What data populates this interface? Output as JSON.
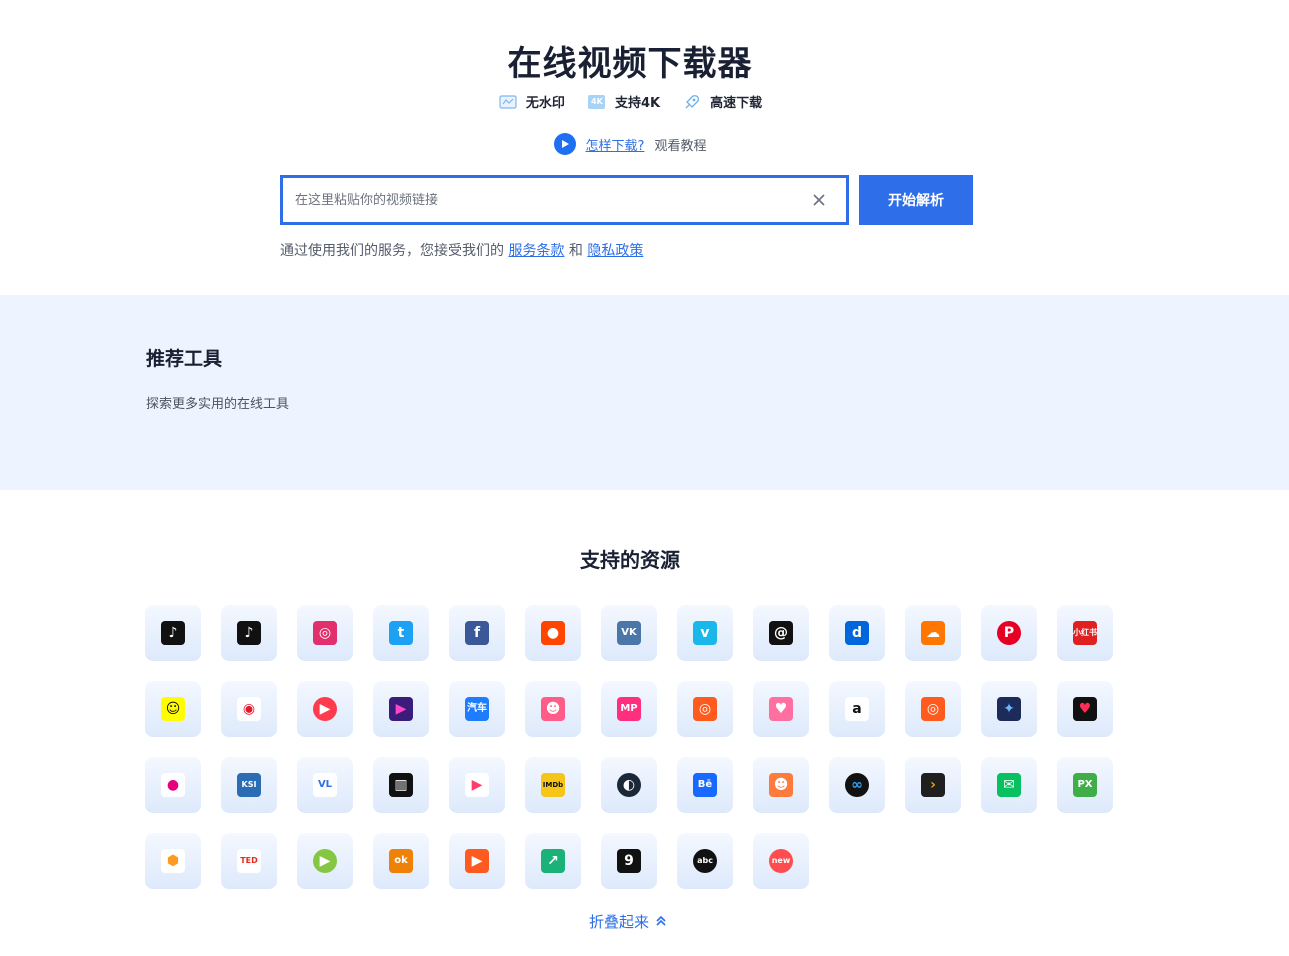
{
  "hero": {
    "title": "在线视频下载器",
    "features": [
      {
        "icon": "no-watermark-icon",
        "label": "无水印"
      },
      {
        "icon": "4k-icon",
        "label": "支持4K",
        "icon_text": "4K"
      },
      {
        "icon": "rocket-icon",
        "label": "高速下载"
      }
    ],
    "tutorial_link": "怎样下载?",
    "tutorial_text": "观看教程"
  },
  "search": {
    "placeholder": "在这里粘贴你的视频链接",
    "value": "",
    "submit_label": "开始解析"
  },
  "terms": {
    "prefix": "通过使用我们的服务，您接受我们的",
    "terms_link": "服务条款",
    "and": "和",
    "privacy_link": "隐私政策"
  },
  "recommended": {
    "title": "推荐工具",
    "subtitle": "探索更多实用的在线工具"
  },
  "sources": {
    "title": "支持的资源",
    "collapse_label": "折叠起来",
    "items": [
      {
        "name": "tiktok",
        "text": "♪",
        "bg": "#111111",
        "fg": "#ffffff"
      },
      {
        "name": "douyin",
        "text": "♪",
        "bg": "#111111",
        "fg": "#ffffff"
      },
      {
        "name": "instagram",
        "text": "◎",
        "bg": "#e1306c",
        "fg": "#ffffff"
      },
      {
        "name": "twitter",
        "text": "t",
        "bg": "#1da1f2",
        "fg": "#ffffff"
      },
      {
        "name": "facebook",
        "text": "f",
        "bg": "#3b5998",
        "fg": "#ffffff"
      },
      {
        "name": "reddit",
        "text": "●",
        "bg": "#ff4500",
        "fg": "#ffffff"
      },
      {
        "name": "vk",
        "text": "VK",
        "bg": "#4a76a8",
        "fg": "#ffffff"
      },
      {
        "name": "vimeo",
        "text": "v",
        "bg": "#19b7ea",
        "fg": "#ffffff"
      },
      {
        "name": "threads",
        "text": "@",
        "bg": "#111111",
        "fg": "#ffffff"
      },
      {
        "name": "dailymotion",
        "text": "d",
        "bg": "#0066dc",
        "fg": "#ffffff"
      },
      {
        "name": "soundcloud",
        "text": "☁",
        "bg": "#ff7700",
        "fg": "#ffffff"
      },
      {
        "name": "pinterest",
        "text": "P",
        "bg": "#e60023",
        "fg": "#ffffff",
        "round": true
      },
      {
        "name": "xiaohongshu",
        "text": "小红书",
        "bg": "#e02020",
        "fg": "#ffffff"
      },
      {
        "name": "snapchat",
        "text": "☺",
        "bg": "#fffc00",
        "fg": "#111111"
      },
      {
        "name": "weibo",
        "text": "◉",
        "bg": "#ffffff",
        "fg": "#e6162d"
      },
      {
        "name": "kuaishou-red",
        "text": "▶",
        "bg": "#ff3b4e",
        "fg": "#ffffff",
        "round": true
      },
      {
        "name": "purple-play",
        "text": "▶",
        "bg": "#3a1c7a",
        "fg": "#ff45c8"
      },
      {
        "name": "autohome",
        "text": "汽车",
        "bg": "#1e7cff",
        "fg": "#ffffff"
      },
      {
        "name": "pink-face",
        "text": "☻",
        "bg": "#ff5c8a",
        "fg": "#ffffff"
      },
      {
        "name": "mp",
        "text": "MP",
        "bg": "#ff2f7d",
        "fg": "#ffffff"
      },
      {
        "name": "kuaishou-orange",
        "text": "◎",
        "bg": "#ff5b1f",
        "fg": "#ffffff"
      },
      {
        "name": "pink-banner",
        "text": "♥",
        "bg": "#ff6fa0",
        "fg": "#ffffff"
      },
      {
        "name": "amazon",
        "text": "a",
        "bg": "#ffffff",
        "fg": "#111111"
      },
      {
        "name": "kuaishou",
        "text": "◎",
        "bg": "#ff5b1f",
        "fg": "#ffffff"
      },
      {
        "name": "star-app",
        "text": "✦",
        "bg": "#1c2b5a",
        "fg": "#6fb6ff"
      },
      {
        "name": "heart-app",
        "text": "♥",
        "bg": "#111111",
        "fg": "#ff2d55"
      },
      {
        "name": "pink-ball",
        "text": "●",
        "bg": "#ffffff",
        "fg": "#e6007e"
      },
      {
        "name": "ksi",
        "text": "KSI",
        "bg": "#2a6db5",
        "fg": "#ffffff"
      },
      {
        "name": "vl",
        "text": "VL",
        "bg": "#ffffff",
        "fg": "#2c6fe6"
      },
      {
        "name": "archive",
        "text": "▥",
        "bg": "#111111",
        "fg": "#ffffff"
      },
      {
        "name": "colorful-play",
        "text": "▶",
        "bg": "#ffffff",
        "fg": "#ff3b6b"
      },
      {
        "name": "imdb",
        "text": "IMDb",
        "bg": "#f5c518",
        "fg": "#111111"
      },
      {
        "name": "steam",
        "text": "◐",
        "bg": "#1b2838",
        "fg": "#ffffff",
        "round": true
      },
      {
        "name": "behance",
        "text": "Bē",
        "bg": "#1769ff",
        "fg": "#ffffff"
      },
      {
        "name": "cartoon",
        "text": "☻",
        "bg": "#ff7a3d",
        "fg": "#ffffff"
      },
      {
        "name": "infinity",
        "text": "∞",
        "bg": "#111111",
        "fg": "#2fa4ff",
        "round": true
      },
      {
        "name": "plex",
        "text": "›",
        "bg": "#1f1f1f",
        "fg": "#e5a00d"
      },
      {
        "name": "wechat",
        "text": "✉",
        "bg": "#07c160",
        "fg": "#ffffff"
      },
      {
        "name": "px",
        "text": "PX",
        "bg": "#3fae49",
        "fg": "#ffffff"
      },
      {
        "name": "hexagon",
        "text": "⬢",
        "bg": "#ffffff",
        "fg": "#ff9a1f"
      },
      {
        "name": "ted",
        "text": "TED",
        "bg": "#ffffff",
        "fg": "#e62b1e"
      },
      {
        "name": "rumble",
        "text": "▶",
        "bg": "#85c742",
        "fg": "#ffffff",
        "round": true
      },
      {
        "name": "odnoklassniki",
        "text": "ok",
        "bg": "#ee8208",
        "fg": "#ffffff"
      },
      {
        "name": "video-box",
        "text": "▶",
        "bg": "#ff5a1f",
        "fg": "#ffffff"
      },
      {
        "name": "green-arrow",
        "text": "↗",
        "bg": "#1bb27a",
        "fg": "#ffffff"
      },
      {
        "name": "ninegag",
        "text": "9",
        "bg": "#111111",
        "fg": "#ffffff"
      },
      {
        "name": "abc",
        "text": "abc",
        "bg": "#111111",
        "fg": "#ffffff",
        "round": true
      },
      {
        "name": "new",
        "text": "new",
        "bg": "#ff4d4f",
        "fg": "#ffffff",
        "round": true
      }
    ]
  }
}
